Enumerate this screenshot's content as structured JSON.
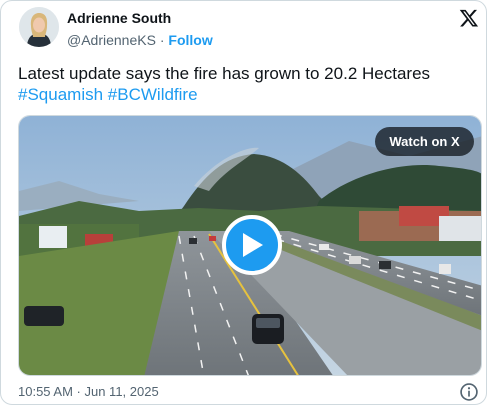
{
  "author": {
    "display_name": "Adrienne South",
    "handle": "@AdrienneKS",
    "separator": "·",
    "follow_label": "Follow"
  },
  "tweet": {
    "text": "Latest update says the fire has grown to 20.2 Hectares",
    "hashtags": [
      "#Squamish",
      "#BCWildfire"
    ]
  },
  "media": {
    "watch_label": "Watch on X",
    "icon": "play-icon"
  },
  "footer": {
    "timestamp": "10:55 AM · Jun 11, 2025",
    "info_icon": "info-icon"
  },
  "colors": {
    "accent": "#1d9bf0",
    "text": "#0f1419",
    "secondary": "#536471",
    "border": "#cfd9de"
  }
}
